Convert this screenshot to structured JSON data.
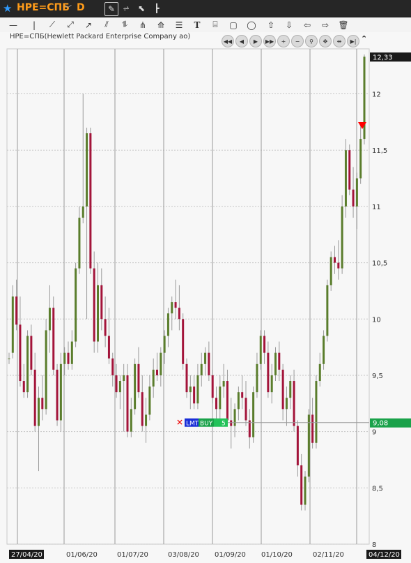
{
  "window": {
    "symbol": "HPE=СПБ",
    "period": "D",
    "star_icon": "star-icon",
    "dropdown_icon": "chevron-down-icon",
    "icons": [
      "draw-tool-icon",
      "bars-icon",
      "cursor-icon",
      "depth-icon"
    ]
  },
  "toolbar": {
    "icons": [
      "horizontal-line-icon",
      "vertical-line-icon",
      "trend-line-icon",
      "ray-icon",
      "arrow-icon",
      "channel-icon",
      "fibonacci-icon",
      "pitchfork-icon",
      "fib-fan-icon",
      "levels-icon",
      "text-icon",
      "label-icon",
      "rectangle-icon",
      "ellipse-icon",
      "arrow-up-icon",
      "arrow-down-icon",
      "arrow-left-icon",
      "arrow-right-icon",
      "trash-icon"
    ],
    "text_glyph": "T"
  },
  "chart": {
    "label": "HPE=СПБ(Hewlett Packard Enterprise Company ао)",
    "last_price": "12,33",
    "line_price": "9,08",
    "order": {
      "type": "LMT",
      "side": "BUY",
      "qty": "5"
    },
    "colors": {
      "up": "#5a7d2c",
      "down": "#a3143a",
      "last_tag": "#1a1a1a",
      "line_tag": "#1aa24a",
      "signal": "#ff0000"
    }
  },
  "chart_data": {
    "type": "candlestick",
    "ylim": [
      8,
      12.4
    ],
    "y_ticks": [
      "8",
      "8,5",
      "9",
      "9,5",
      "10",
      "10,5",
      "11",
      "11,5",
      "12"
    ],
    "x_labels": [
      "27/04/20",
      "01/06/20",
      "01/07/20",
      "03/08/20",
      "01/09/20",
      "01/10/20",
      "02/11/20",
      "04/12/20"
    ],
    "candles": [
      [
        9.65,
        9.7,
        9.6,
        9.65
      ],
      [
        9.7,
        10.3,
        9.65,
        10.2
      ],
      [
        10.2,
        10.35,
        9.9,
        9.95
      ],
      [
        9.95,
        10.2,
        9.4,
        9.45
      ],
      [
        9.45,
        9.6,
        9.3,
        9.35
      ],
      [
        9.35,
        9.9,
        9.3,
        9.85
      ],
      [
        9.85,
        9.95,
        9.5,
        9.55
      ],
      [
        9.55,
        9.7,
        9.0,
        9.05
      ],
      [
        9.05,
        9.4,
        8.65,
        9.3
      ],
      [
        9.3,
        9.5,
        9.1,
        9.2
      ],
      [
        9.2,
        10.0,
        9.15,
        9.9
      ],
      [
        9.9,
        10.3,
        9.7,
        10.1
      ],
      [
        10.1,
        10.2,
        9.5,
        9.55
      ],
      [
        9.55,
        9.6,
        9.05,
        9.1
      ],
      [
        9.1,
        9.7,
        9.0,
        9.6
      ],
      [
        9.6,
        9.75,
        9.5,
        9.7
      ],
      [
        9.7,
        9.8,
        9.55,
        9.6
      ],
      [
        9.6,
        9.9,
        9.55,
        9.8
      ],
      [
        9.8,
        10.5,
        9.75,
        10.45
      ],
      [
        10.45,
        11.0,
        10.4,
        10.9
      ],
      [
        10.9,
        12.0,
        10.85,
        11.0
      ],
      [
        11.0,
        11.7,
        10.0,
        11.65
      ],
      [
        11.65,
        11.7,
        10.4,
        10.45
      ],
      [
        10.45,
        10.6,
        9.7,
        9.8
      ],
      [
        9.8,
        10.5,
        9.7,
        10.3
      ],
      [
        10.3,
        10.45,
        9.9,
        10.0
      ],
      [
        10.0,
        10.2,
        9.75,
        9.85
      ],
      [
        9.85,
        10.1,
        9.6,
        9.65
      ],
      [
        9.65,
        9.7,
        9.4,
        9.5
      ],
      [
        9.5,
        9.6,
        9.3,
        9.35
      ],
      [
        9.35,
        9.5,
        9.2,
        9.45
      ],
      [
        9.45,
        9.6,
        9.0,
        9.5
      ],
      [
        9.5,
        9.6,
        8.95,
        9.0
      ],
      [
        9.0,
        9.3,
        8.95,
        9.2
      ],
      [
        9.2,
        9.65,
        9.15,
        9.6
      ],
      [
        9.6,
        9.75,
        9.3,
        9.35
      ],
      [
        9.35,
        9.5,
        9.0,
        9.05
      ],
      [
        9.05,
        9.3,
        8.9,
        9.15
      ],
      [
        9.15,
        9.5,
        9.1,
        9.4
      ],
      [
        9.4,
        9.65,
        9.3,
        9.55
      ],
      [
        9.55,
        9.7,
        9.45,
        9.5
      ],
      [
        9.5,
        9.75,
        9.4,
        9.7
      ],
      [
        9.7,
        9.9,
        9.6,
        9.85
      ],
      [
        9.85,
        10.1,
        9.75,
        10.05
      ],
      [
        10.05,
        10.2,
        9.9,
        10.15
      ],
      [
        10.15,
        10.35,
        10.0,
        10.1
      ],
      [
        10.1,
        10.3,
        9.9,
        10.0
      ],
      [
        10.0,
        10.05,
        9.55,
        9.6
      ],
      [
        9.6,
        9.65,
        9.3,
        9.35
      ],
      [
        9.35,
        9.5,
        9.2,
        9.4
      ],
      [
        9.4,
        9.5,
        9.2,
        9.25
      ],
      [
        9.25,
        9.6,
        9.2,
        9.5
      ],
      [
        9.5,
        9.7,
        9.4,
        9.6
      ],
      [
        9.6,
        9.75,
        9.5,
        9.7
      ],
      [
        9.7,
        9.8,
        9.45,
        9.5
      ],
      [
        9.5,
        9.55,
        9.25,
        9.3
      ],
      [
        9.3,
        9.4,
        9.1,
        9.2
      ],
      [
        9.2,
        9.5,
        9.1,
        9.4
      ],
      [
        9.4,
        9.6,
        9.3,
        9.45
      ],
      [
        9.45,
        9.55,
        9.05,
        9.1
      ],
      [
        9.1,
        9.3,
        8.85,
        9.05
      ],
      [
        9.05,
        9.25,
        8.95,
        9.2
      ],
      [
        9.2,
        9.4,
        9.1,
        9.35
      ],
      [
        9.35,
        9.5,
        9.2,
        9.3
      ],
      [
        9.3,
        9.45,
        9.05,
        9.1
      ],
      [
        9.1,
        9.2,
        8.85,
        8.95
      ],
      [
        8.95,
        9.4,
        8.9,
        9.35
      ],
      [
        9.35,
        9.7,
        9.3,
        9.6
      ],
      [
        9.6,
        9.9,
        9.55,
        9.85
      ],
      [
        9.85,
        9.9,
        9.6,
        9.7
      ],
      [
        9.7,
        9.8,
        9.3,
        9.35
      ],
      [
        9.35,
        9.6,
        9.25,
        9.5
      ],
      [
        9.5,
        9.75,
        9.45,
        9.7
      ],
      [
        9.7,
        9.8,
        9.45,
        9.55
      ],
      [
        9.55,
        9.6,
        9.1,
        9.2
      ],
      [
        9.2,
        9.4,
        9.05,
        9.3
      ],
      [
        9.3,
        9.5,
        9.2,
        9.45
      ],
      [
        9.45,
        9.55,
        9.0,
        9.05
      ],
      [
        9.05,
        9.1,
        8.6,
        8.7
      ],
      [
        8.7,
        8.8,
        8.3,
        8.35
      ],
      [
        8.35,
        8.65,
        8.3,
        8.6
      ],
      [
        8.6,
        9.2,
        8.55,
        9.15
      ],
      [
        9.15,
        9.3,
        8.85,
        8.9
      ],
      [
        8.9,
        9.5,
        8.85,
        9.45
      ],
      [
        9.45,
        9.7,
        9.4,
        9.6
      ],
      [
        9.6,
        9.9,
        9.55,
        9.85
      ],
      [
        9.85,
        10.35,
        9.8,
        10.3
      ],
      [
        10.3,
        10.6,
        10.25,
        10.55
      ],
      [
        10.55,
        10.65,
        10.4,
        10.5
      ],
      [
        10.5,
        10.7,
        10.35,
        10.45
      ],
      [
        10.45,
        11.1,
        10.4,
        11.0
      ],
      [
        11.0,
        11.6,
        10.9,
        11.5
      ],
      [
        11.5,
        11.55,
        11.1,
        11.15
      ],
      [
        11.15,
        11.35,
        10.9,
        11.0
      ],
      [
        11.0,
        11.3,
        10.8,
        11.25
      ],
      [
        11.25,
        11.75,
        11.2,
        11.6
      ],
      [
        11.6,
        12.35,
        11.55,
        12.33
      ]
    ]
  }
}
